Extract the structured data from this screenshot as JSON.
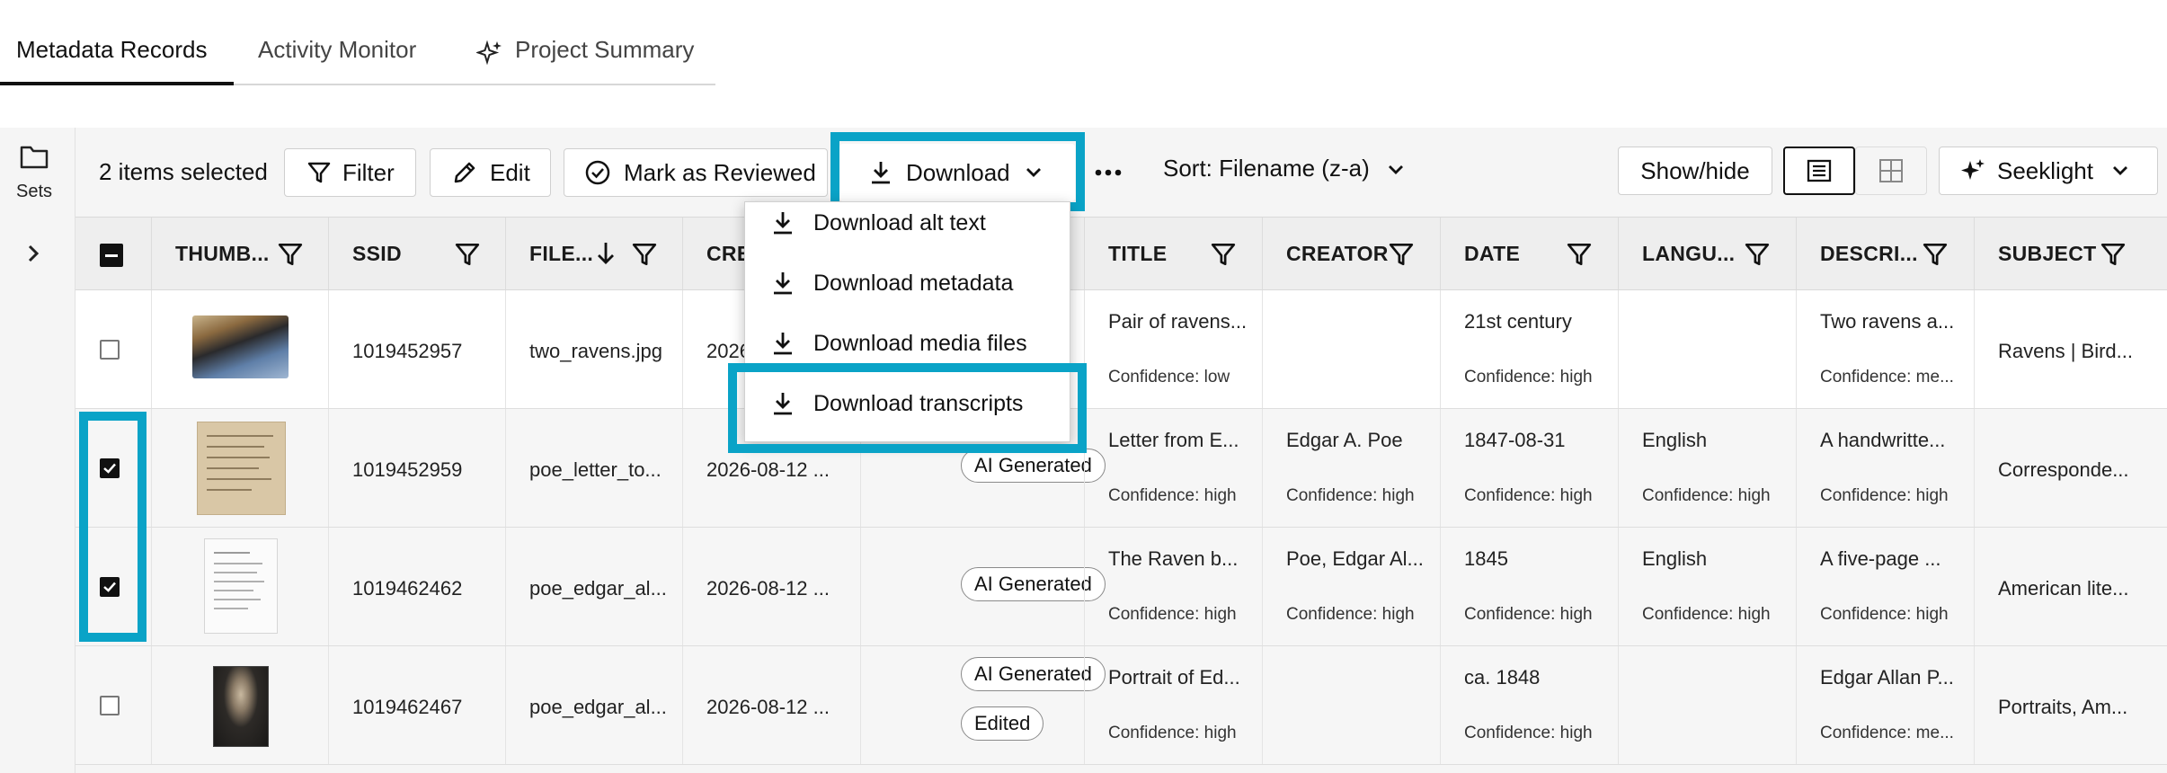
{
  "tabs": [
    {
      "label": "Metadata Records",
      "active": true
    },
    {
      "label": "Activity Monitor",
      "active": false
    },
    {
      "label": "Project Summary",
      "active": false,
      "icon": "sparkle-icon"
    }
  ],
  "sidebar": {
    "sets_label": "Sets",
    "expand_icon": "chevron-right-icon"
  },
  "toolbar": {
    "selection_text": "2 items selected",
    "filter_label": "Filter",
    "edit_label": "Edit",
    "mark_reviewed_label": "Mark as Reviewed",
    "download_label": "Download",
    "sort_label": "Sort: Filename (z-a)",
    "show_hide_label": "Show/hide",
    "seeklight_label": "Seeklight"
  },
  "download_menu": {
    "items": [
      "Download alt text",
      "Download metadata",
      "Download media files",
      "Download transcripts"
    ],
    "highlighted": "Download transcripts"
  },
  "columns": [
    "THUMB...",
    "SSID",
    "FILE...",
    "CRE",
    "TITLE",
    "CREATOR",
    "DATE",
    "LANGU...",
    "DESCRI...",
    "SUBJECT"
  ],
  "rows": [
    {
      "checked": false,
      "ssid": "1019452957",
      "file": "two_ravens.jpg",
      "created": "2026",
      "tags": [],
      "title": "Pair of ravens...",
      "title_conf": "Confidence: low",
      "creator": "",
      "creator_conf": "",
      "date": "21st century",
      "date_conf": "Confidence: high",
      "language": "",
      "language_conf": "",
      "description": "Two ravens a...",
      "description_conf": "Confidence: me...",
      "subject": "Ravens | Bird..."
    },
    {
      "checked": true,
      "ssid": "1019452959",
      "file": "poe_letter_to...",
      "created": "2026-08-12 ...",
      "tags": [
        "AI Generated"
      ],
      "title": "Letter from E...",
      "title_conf": "Confidence: high",
      "creator": "Edgar A. Poe",
      "creator_conf": "Confidence: high",
      "date": "1847-08-31",
      "date_conf": "Confidence: high",
      "language": "English",
      "language_conf": "Confidence: high",
      "description": "A handwritte...",
      "description_conf": "Confidence: high",
      "subject": "Corresponde..."
    },
    {
      "checked": true,
      "ssid": "1019462462",
      "file": "poe_edgar_al...",
      "created": "2026-08-12 ...",
      "tags": [
        "AI Generated"
      ],
      "title": "The Raven b...",
      "title_conf": "Confidence: high",
      "creator": "Poe, Edgar Al...",
      "creator_conf": "Confidence: high",
      "date": "1845",
      "date_conf": "Confidence: high",
      "language": "English",
      "language_conf": "Confidence: high",
      "description": "A five-page ...",
      "description_conf": "Confidence: high",
      "subject": "American lite..."
    },
    {
      "checked": false,
      "ssid": "1019462467",
      "file": "poe_edgar_al...",
      "created": "2026-08-12 ...",
      "tags": [
        "AI Generated",
        "Edited"
      ],
      "title": "Portrait of Ed...",
      "title_conf": "Confidence: high",
      "creator": "",
      "creator_conf": "",
      "date": "ca. 1848",
      "date_conf": "Confidence: high",
      "language": "",
      "language_conf": "",
      "description": "Edgar Allan P...",
      "description_conf": "Confidence: me...",
      "subject": "Portraits, Am..."
    }
  ],
  "colors": {
    "highlight": "#0aa3c7",
    "header_bg": "#eeeeee"
  }
}
